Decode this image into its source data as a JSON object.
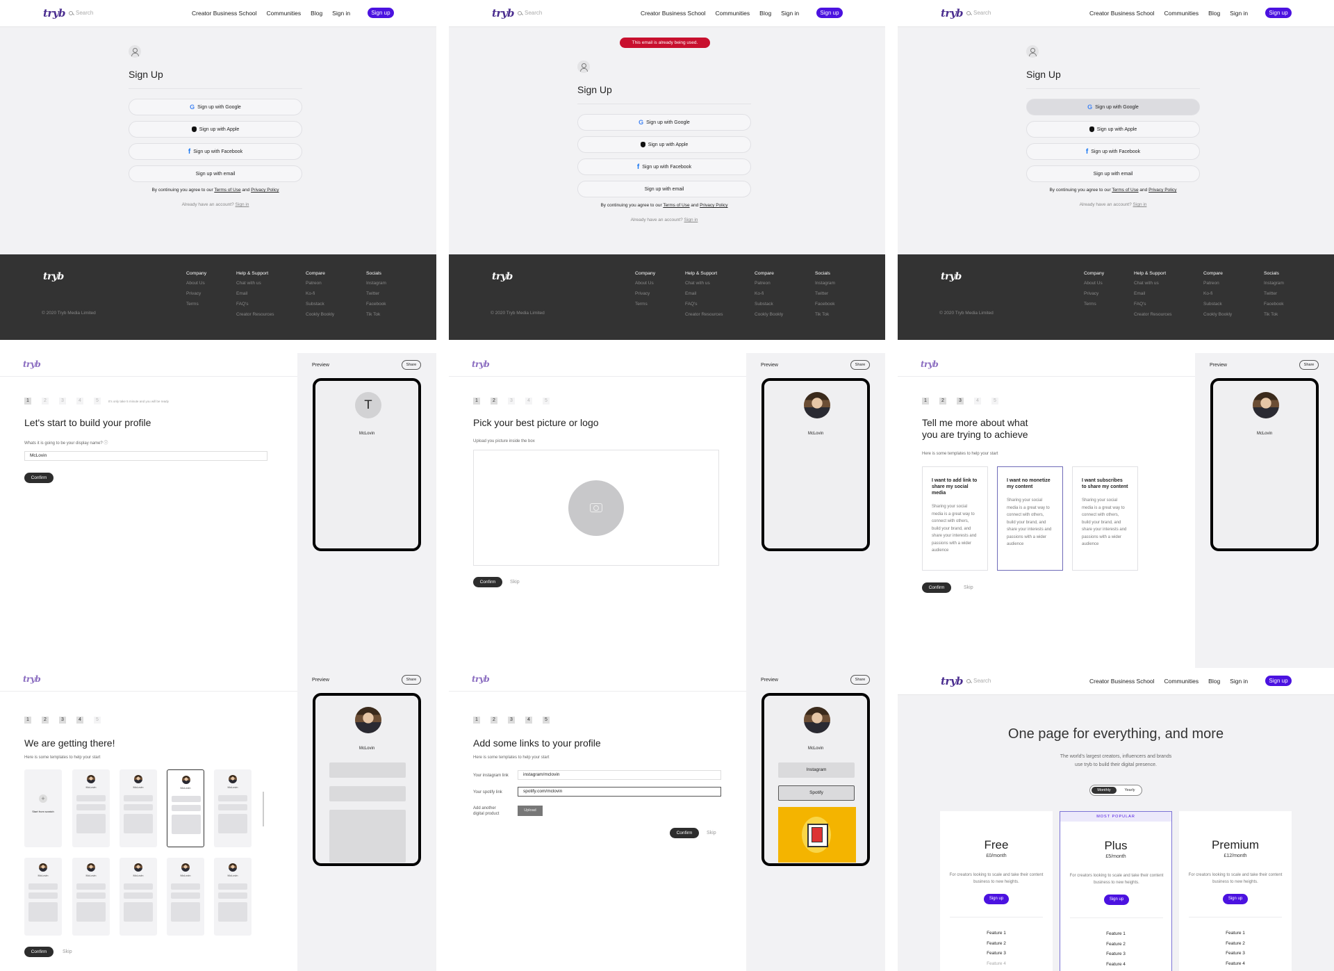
{
  "nav": {
    "logo": "tryb",
    "search_placeholder": "Search",
    "links": [
      "Creator Business School",
      "Communities",
      "Blog",
      "Sign in"
    ],
    "signup": "Sign up"
  },
  "signup": {
    "title": "Sign Up",
    "google": "Sign up with Google",
    "apple": "Sign up with Apple",
    "facebook": "Sign up with Facebook",
    "email": "Sign up with email",
    "legal_prefix": "By continuing you agree to our",
    "terms": "Terms of Use",
    "and": "and",
    "privacy": "Privacy Policy",
    "already": "Already have an account?",
    "signin": "Sign in",
    "error": "This email is already being used."
  },
  "footer": {
    "logo": "tryb",
    "copyright": "© 2020 Tryb Media Limited",
    "columns": [
      {
        "title": "Company",
        "items": [
          "About Us",
          "Privacy",
          "Terms"
        ]
      },
      {
        "title": "Help & Support",
        "items": [
          "Chat with us",
          "Email",
          "FAQ's",
          "Creator Resources"
        ]
      },
      {
        "title": "Compare",
        "items": [
          "Patreon",
          "Ko-fi",
          "Substack",
          "Cookly Bookly"
        ]
      },
      {
        "title": "Socials",
        "items": [
          "Instagram",
          "Twitter",
          "Facebook",
          "Tik Tok"
        ]
      }
    ]
  },
  "builder": {
    "logo": "tryb",
    "steps": [
      "1",
      "2",
      "3",
      "4",
      "5"
    ],
    "steps_note": "It's only take 5 minute and you will be ready",
    "preview_label": "Preview",
    "share": "Share",
    "profile_name": "McLovin",
    "avatar_letter": "T",
    "confirm": "Confirm",
    "skip": "Skip",
    "step1": {
      "title": "Let's start to build your profile",
      "question": "Whats it is going to be your display name?",
      "help_icon": "info-icon",
      "value": "McLovin"
    },
    "step2": {
      "title": "Pick your best picture or logo",
      "subtitle": "Upload you picture inside the box"
    },
    "step3": {
      "title_line1": "Tell me more about what",
      "title_line2": "you are trying to achieve",
      "subtitle": "Here is some templates to help your start",
      "cards": [
        {
          "title": "I want to add link to share my social media",
          "body": "Sharing your social media is a great way to connect with others, build your brand, and share your interests and passions with a wider audience"
        },
        {
          "title": "I want no monetize my content",
          "body": "Sharing your social media is a great way to connect with others, build your brand, and share your interests and passions with a wider audience"
        },
        {
          "title": "I want subscribes to share my content",
          "body": "Sharing your social media is a great way to connect with others, build your brand, and share your interests and passions with a wider audience"
        }
      ]
    },
    "step4": {
      "title": "We are getting there!",
      "subtitle": "Here is some templates to help your start",
      "start_scratch": "Start from scratch"
    },
    "step5": {
      "title": "Add some links to your profile",
      "subtitle": "Here is some templates to help your start",
      "instagram_label": "Your instagram link",
      "instagram_value": "instagram/mclovin",
      "spotify_label": "Your spotify link",
      "spotify_value": "spotify.com/mclovin",
      "digital_label_1": "Add another",
      "digital_label_2": "digital product",
      "upload": "Upload",
      "preview_links": [
        "Instagram",
        "Spotify"
      ]
    }
  },
  "pricing": {
    "title": "One page for everything, and more",
    "subtitle_line1": "The world's largest creators, influencers and brands",
    "subtitle_line2": "use tryb to build their digital presence.",
    "toggle": [
      "Monthly",
      "Yearly"
    ],
    "most_popular": "MOST POPULAR",
    "plans": [
      {
        "name": "Free",
        "price": "£0/month",
        "desc": "For creators looking to scale and take their content business to new heights.",
        "cta": "Sign up",
        "features": [
          "Feature 1",
          "Feature 2",
          "Feature 3",
          "Feature 4"
        ]
      },
      {
        "name": "Plus",
        "price": "£5/month",
        "desc": "For creators looking to scale and take their content business to new heights.",
        "cta": "Sign up",
        "features": [
          "Feature 1",
          "Feature 2",
          "Feature 3",
          "Feature 4"
        ]
      },
      {
        "name": "Premium",
        "price": "£12/month",
        "desc": "For creators looking to scale and take their content business to new heights.",
        "cta": "Sign up",
        "features": [
          "Feature 1",
          "Feature 2",
          "Feature 3",
          "Feature 4"
        ]
      }
    ]
  },
  "colors": {
    "brand": "#4b12e0",
    "logo": "#4a2d8f",
    "error": "#c8102e",
    "footer": "#333333",
    "dark_button": "#2d2d2d"
  }
}
